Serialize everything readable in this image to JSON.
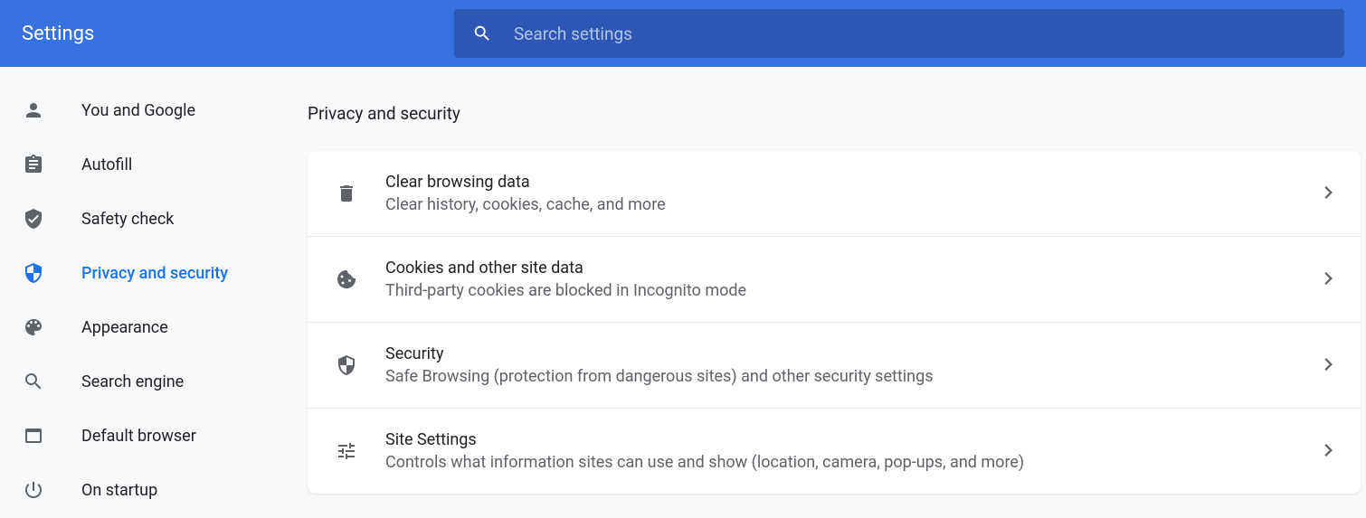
{
  "header": {
    "title": "Settings",
    "search_placeholder": "Search settings"
  },
  "sidebar": {
    "items": [
      {
        "label": "You and Google",
        "icon": "person",
        "active": false
      },
      {
        "label": "Autofill",
        "icon": "clipboard",
        "active": false
      },
      {
        "label": "Safety check",
        "icon": "shield-check",
        "active": false
      },
      {
        "label": "Privacy and security",
        "icon": "shield-half",
        "active": true
      },
      {
        "label": "Appearance",
        "icon": "palette",
        "active": false
      },
      {
        "label": "Search engine",
        "icon": "search",
        "active": false
      },
      {
        "label": "Default browser",
        "icon": "browser",
        "active": false
      },
      {
        "label": "On startup",
        "icon": "power",
        "active": false
      }
    ]
  },
  "main": {
    "section_title": "Privacy and security",
    "rows": [
      {
        "title": "Clear browsing data",
        "desc": "Clear history, cookies, cache, and more",
        "icon": "trash"
      },
      {
        "title": "Cookies and other site data",
        "desc": "Third-party cookies are blocked in Incognito mode",
        "icon": "cookie"
      },
      {
        "title": "Security",
        "desc": "Safe Browsing (protection from dangerous sites) and other security settings",
        "icon": "shield"
      },
      {
        "title": "Site Settings",
        "desc": "Controls what information sites can use and show (location, camera, pop-ups, and more)",
        "icon": "tune"
      }
    ]
  }
}
